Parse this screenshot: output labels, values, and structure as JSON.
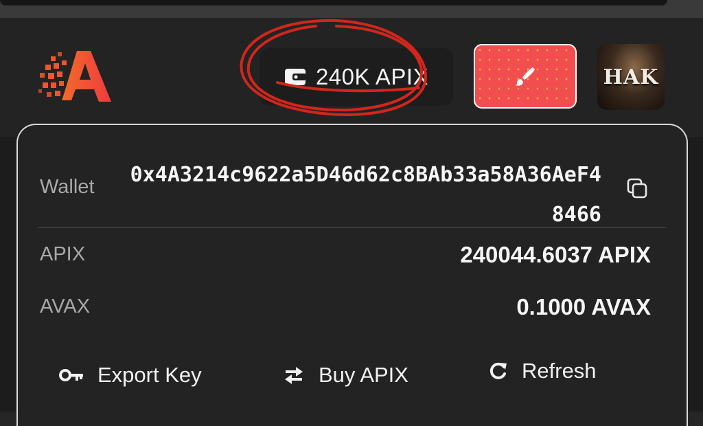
{
  "header": {
    "balance_label": "240K APIX",
    "avatar_text": "HAK"
  },
  "wallet": {
    "label": "Wallet",
    "address": "0x4A3214c9622a5D46d62c8BAb33a58A36AeF48466"
  },
  "balances": [
    {
      "label": "APIX",
      "value": "240044.6037 APIX"
    },
    {
      "label": "AVAX",
      "value": "0.1000 AVAX"
    }
  ],
  "actions": {
    "export_key": "Export Key",
    "buy_apix": "Buy APIX",
    "refresh": "Refresh"
  },
  "icons": {
    "logo": "apix-logo",
    "wallet": "wallet-icon",
    "brush": "brush-icon",
    "copy": "copy-icon",
    "key": "key-icon",
    "swap": "swap-arrows-icon",
    "refresh": "refresh-icon"
  },
  "colors": {
    "accent": "#f24e50",
    "annotation": "#d2261c",
    "panel_background": "#232323"
  }
}
